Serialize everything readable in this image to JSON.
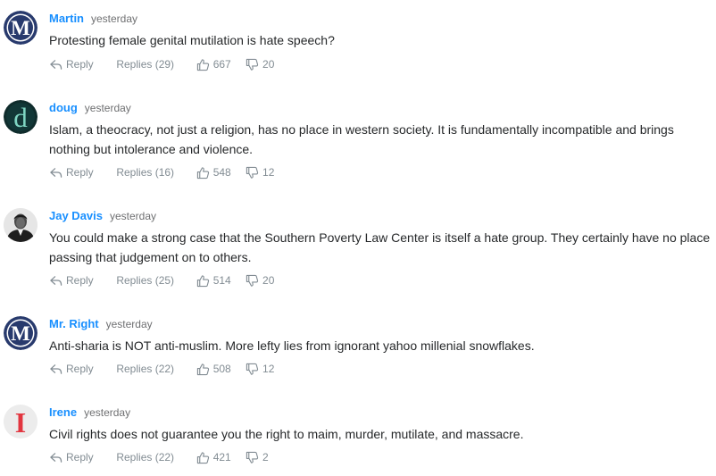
{
  "comments": [
    {
      "author": "Martin",
      "time": "yesterday",
      "text": "Protesting female genital mutilation is hate speech?",
      "reply_label": "Reply",
      "replies_label": "Replies (29)",
      "upvotes": "667",
      "downvotes": "20",
      "avatar": {
        "glyph": "M",
        "style": "letter-circle",
        "color": "#283a6d"
      }
    },
    {
      "author": "doug",
      "time": "yesterday",
      "text": "Islam, a theocracy, not just a religion, has no place in western society. It is fundamentally incompatible and brings nothing but intolerance and violence.",
      "reply_label": "Reply",
      "replies_label": "Replies (16)",
      "upvotes": "548",
      "downvotes": "12",
      "avatar": {
        "glyph": "d",
        "style": "letter-dark",
        "color": "#7fd6c3"
      }
    },
    {
      "author": "Jay Davis",
      "time": "yesterday",
      "text": "You could make a strong case that the Southern Poverty Law Center is itself a hate group. They certainly have no place passing that judgement on to others.",
      "reply_label": "Reply",
      "replies_label": "Replies (25)",
      "upvotes": "514",
      "downvotes": "20",
      "avatar": {
        "glyph": "",
        "style": "portrait",
        "color": "#2b2b2b"
      }
    },
    {
      "author": "Mr. Right",
      "time": "yesterday",
      "text": "Anti-sharia is NOT anti-muslim. More lefty lies from ignorant yahoo millenial snowflakes.",
      "reply_label": "Reply",
      "replies_label": "Replies (22)",
      "upvotes": "508",
      "downvotes": "12",
      "avatar": {
        "glyph": "M",
        "style": "letter-circle",
        "color": "#283a6d"
      }
    },
    {
      "author": "Irene",
      "time": "yesterday",
      "text": "Civil rights does not guarantee you the right to maim, murder, mutilate, and massacre.",
      "reply_label": "Reply",
      "replies_label": "Replies (22)",
      "upvotes": "421",
      "downvotes": "2",
      "avatar": {
        "glyph": "I",
        "style": "letter-light",
        "color": "#e2353f"
      }
    }
  ],
  "colors": {
    "author_link": "#188fff",
    "body_text": "#26282a",
    "meta_text": "#828c93",
    "timestamp": "#6f7072"
  }
}
